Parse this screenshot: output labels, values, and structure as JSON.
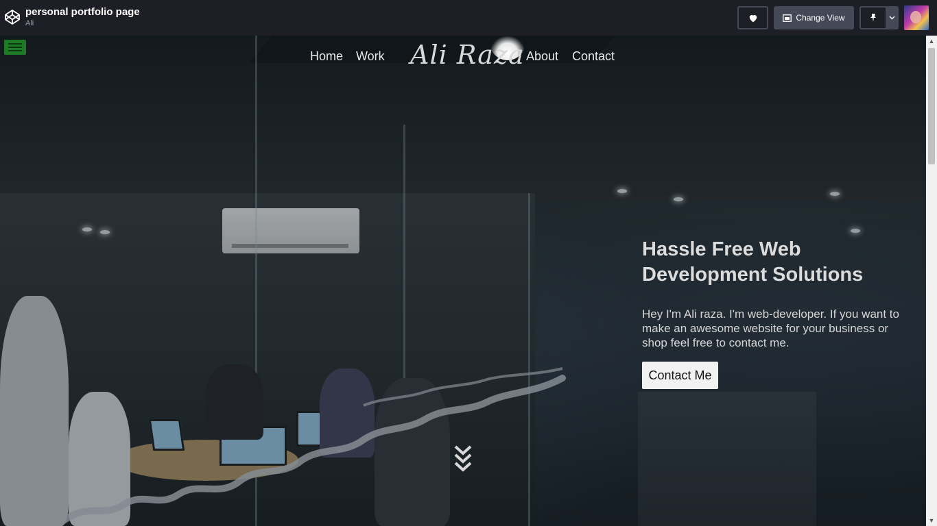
{
  "editor": {
    "title": "personal portfolio page",
    "author": "Ali",
    "change_view_label": "Change View"
  },
  "site": {
    "brand": "Ali Raza",
    "nav": [
      "Home",
      "Work",
      "About",
      "Contact"
    ],
    "hero_title": "Hassle Free Web Development Solutions",
    "hero_text": "Hey I'm Ali raza. I'm web-developer. If you want to make an awesome website for your business or shop feel free to contact me.",
    "cta_label": "Contact Me"
  },
  "colors": {
    "topbar": "#1e1f26",
    "button_gray": "#444857",
    "menu_toggle": "#1f7a27",
    "cta_bg": "#f2f2f2"
  },
  "icons": {
    "logo": "codepen-icon",
    "heart": "heart-icon",
    "change_view": "layout-icon",
    "pin": "pin-icon",
    "dropdown": "chevron-down-icon",
    "menu": "hamburger-icon",
    "scroll_hint": "double-chevron-down-icon"
  }
}
